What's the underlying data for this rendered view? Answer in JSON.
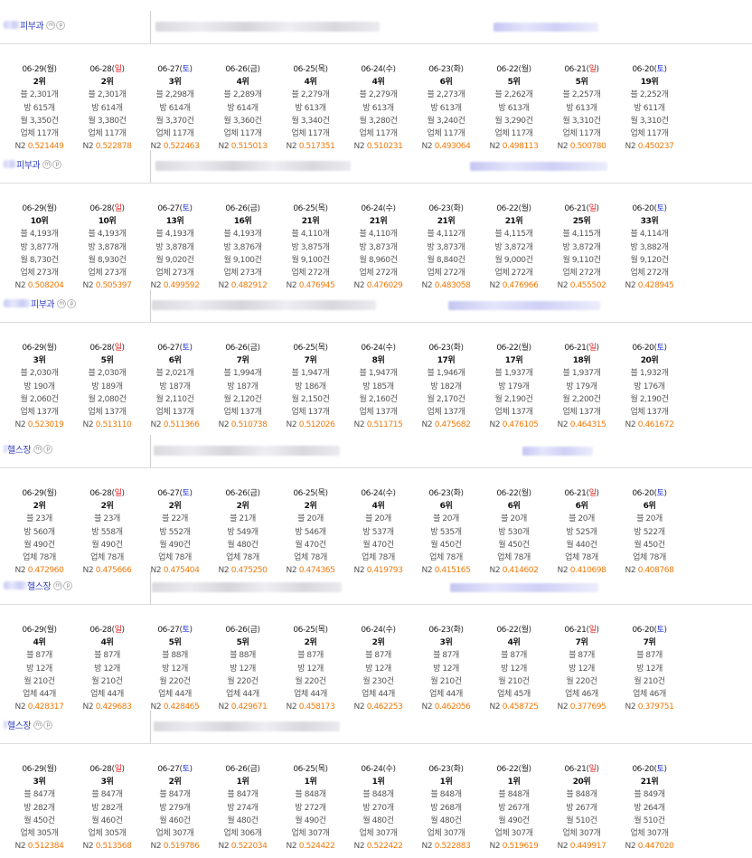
{
  "shops": [
    {
      "name": "피부과",
      "mp_icons": [
        "m",
        "p"
      ],
      "columns": [
        {
          "date": "06-29",
          "weekday": "월",
          "rank": "2위",
          "blog": "블 2,301개",
          "bang": "방 615개",
          "month": "월 3,350건",
          "biz": "업체 117개",
          "n2_label": "N2",
          "n2": "0.521449"
        },
        {
          "date": "06-28",
          "weekday": "일",
          "rank": "2위",
          "blog": "블 2,301개",
          "bang": "방 614개",
          "month": "월 3,380건",
          "biz": "업체 117개",
          "n2_label": "N2",
          "n2": "0.522878"
        },
        {
          "date": "06-27",
          "weekday": "토",
          "rank": "3위",
          "blog": "블 2,298개",
          "bang": "방 614개",
          "month": "월 3,370건",
          "biz": "업체 117개",
          "n2_label": "N2",
          "n2": "0.522463"
        },
        {
          "date": "06-26",
          "weekday": "금",
          "rank": "4위",
          "blog": "블 2,289개",
          "bang": "방 614개",
          "month": "월 3,360건",
          "biz": "업체 117개",
          "n2_label": "N2",
          "n2": "0.515013"
        },
        {
          "date": "06-25",
          "weekday": "목",
          "rank": "4위",
          "blog": "블 2,279개",
          "bang": "방 613개",
          "month": "월 3,340건",
          "biz": "업체 117개",
          "n2_label": "N2",
          "n2": "0.517351"
        },
        {
          "date": "06-24",
          "weekday": "수",
          "rank": "4위",
          "blog": "블 2,279개",
          "bang": "방 613개",
          "month": "월 3,280건",
          "biz": "업체 117개",
          "n2_label": "N2",
          "n2": "0.510231"
        },
        {
          "date": "06-23",
          "weekday": "화",
          "rank": "6위",
          "blog": "블 2,273개",
          "bang": "방 613개",
          "month": "월 3,240건",
          "biz": "업체 117개",
          "n2_label": "N2",
          "n2": "0.493064"
        },
        {
          "date": "06-22",
          "weekday": "월",
          "rank": "5위",
          "blog": "블 2,262개",
          "bang": "방 613개",
          "month": "월 3,290건",
          "biz": "업체 117개",
          "n2_label": "N2",
          "n2": "0.498113"
        },
        {
          "date": "06-21",
          "weekday": "일",
          "rank": "5위",
          "blog": "블 2,257개",
          "bang": "방 613개",
          "month": "월 3,310건",
          "biz": "업체 117개",
          "n2_label": "N2",
          "n2": "0.500780"
        },
        {
          "date": "06-20",
          "weekday": "토",
          "rank": "19위",
          "blog": "블 2,252개",
          "bang": "방 611개",
          "month": "월 3,310건",
          "biz": "업체 117개",
          "n2_label": "N2",
          "n2": "0.450237"
        }
      ]
    },
    {
      "name": "피부과",
      "mp_icons": [
        "m",
        "p"
      ],
      "columns": [
        {
          "date": "06-29",
          "weekday": "월",
          "rank": "10위",
          "blog": "블 4,193개",
          "bang": "방 3,877개",
          "month": "월 8,730건",
          "biz": "업체 273개",
          "n2_label": "N2",
          "n2": "0.508204"
        },
        {
          "date": "06-28",
          "weekday": "일",
          "rank": "10위",
          "blog": "블 4,193개",
          "bang": "방 3,878개",
          "month": "월 8,930건",
          "biz": "업체 273개",
          "n2_label": "N2",
          "n2": "0.505397"
        },
        {
          "date": "06-27",
          "weekday": "토",
          "rank": "13위",
          "blog": "블 4,193개",
          "bang": "방 3,878개",
          "month": "월 9,020건",
          "biz": "업체 273개",
          "n2_label": "N2",
          "n2": "0.499592"
        },
        {
          "date": "06-26",
          "weekday": "금",
          "rank": "16위",
          "blog": "블 4,193개",
          "bang": "방 3,876개",
          "month": "월 9,100건",
          "biz": "업체 273개",
          "n2_label": "N2",
          "n2": "0.482912"
        },
        {
          "date": "06-25",
          "weekday": "목",
          "rank": "21위",
          "blog": "블 4,110개",
          "bang": "방 3,875개",
          "month": "월 9,100건",
          "biz": "업체 272개",
          "n2_label": "N2",
          "n2": "0.476945"
        },
        {
          "date": "06-24",
          "weekday": "수",
          "rank": "21위",
          "blog": "블 4,110개",
          "bang": "방 3,873개",
          "month": "월 8,960건",
          "biz": "업체 272개",
          "n2_label": "N2",
          "n2": "0.476029"
        },
        {
          "date": "06-23",
          "weekday": "화",
          "rank": "21위",
          "blog": "블 4,112개",
          "bang": "방 3,873개",
          "month": "월 8,840건",
          "biz": "업체 272개",
          "n2_label": "N2",
          "n2": "0.483058"
        },
        {
          "date": "06-22",
          "weekday": "월",
          "rank": "21위",
          "blog": "블 4,115개",
          "bang": "방 3,872개",
          "month": "월 9,000건",
          "biz": "업체 272개",
          "n2_label": "N2",
          "n2": "0.476966"
        },
        {
          "date": "06-21",
          "weekday": "일",
          "rank": "25위",
          "blog": "블 4,115개",
          "bang": "방 3,872개",
          "month": "월 9,110건",
          "biz": "업체 272개",
          "n2_label": "N2",
          "n2": "0.455502"
        },
        {
          "date": "06-20",
          "weekday": "토",
          "rank": "33위",
          "blog": "블 4,114개",
          "bang": "방 3,882개",
          "month": "월 9,120건",
          "biz": "업체 272개",
          "n2_label": "N2",
          "n2": "0.428945"
        }
      ]
    },
    {
      "name": "피부과",
      "mp_icons": [
        "m",
        "p"
      ],
      "columns": [
        {
          "date": "06-29",
          "weekday": "월",
          "rank": "3위",
          "blog": "블 2,030개",
          "bang": "방 190개",
          "month": "월 2,060건",
          "biz": "업체 137개",
          "n2_label": "N2",
          "n2": "0.523019"
        },
        {
          "date": "06-28",
          "weekday": "일",
          "rank": "5위",
          "blog": "블 2,030개",
          "bang": "방 189개",
          "month": "월 2,080건",
          "biz": "업체 137개",
          "n2_label": "N2",
          "n2": "0.513110"
        },
        {
          "date": "06-27",
          "weekday": "토",
          "rank": "6위",
          "blog": "블 2,021개",
          "bang": "방 187개",
          "month": "월 2,110건",
          "biz": "업체 137개",
          "n2_label": "N2",
          "n2": "0.511366"
        },
        {
          "date": "06-26",
          "weekday": "금",
          "rank": "7위",
          "blog": "블 1,994개",
          "bang": "방 187개",
          "month": "월 2,120건",
          "biz": "업체 137개",
          "n2_label": "N2",
          "n2": "0.510738"
        },
        {
          "date": "06-25",
          "weekday": "목",
          "rank": "7위",
          "blog": "블 1,947개",
          "bang": "방 186개",
          "month": "월 2,150건",
          "biz": "업체 137개",
          "n2_label": "N2",
          "n2": "0.512026"
        },
        {
          "date": "06-24",
          "weekday": "수",
          "rank": "8위",
          "blog": "블 1,947개",
          "bang": "방 185개",
          "month": "월 2,160건",
          "biz": "업체 137개",
          "n2_label": "N2",
          "n2": "0.511715"
        },
        {
          "date": "06-23",
          "weekday": "화",
          "rank": "17위",
          "blog": "블 1,946개",
          "bang": "방 182개",
          "month": "월 2,170건",
          "biz": "업체 137개",
          "n2_label": "N2",
          "n2": "0.475682"
        },
        {
          "date": "06-22",
          "weekday": "월",
          "rank": "17위",
          "blog": "블 1,937개",
          "bang": "방 179개",
          "month": "월 2,190건",
          "biz": "업체 137개",
          "n2_label": "N2",
          "n2": "0.476105"
        },
        {
          "date": "06-21",
          "weekday": "일",
          "rank": "18위",
          "blog": "블 1,937개",
          "bang": "방 179개",
          "month": "월 2,200건",
          "biz": "업체 137개",
          "n2_label": "N2",
          "n2": "0.464315"
        },
        {
          "date": "06-20",
          "weekday": "토",
          "rank": "20위",
          "blog": "블 1,932개",
          "bang": "방 176개",
          "month": "월 2,190건",
          "biz": "업체 137개",
          "n2_label": "N2",
          "n2": "0.461672"
        }
      ]
    },
    {
      "name": "헬스장",
      "mp_icons": [
        "m",
        "p"
      ],
      "columns": [
        {
          "date": "06-29",
          "weekday": "월",
          "rank": "2위",
          "blog": "블 23개",
          "bang": "방 560개",
          "month": "월 490건",
          "biz": "업체 78개",
          "n2_label": "N2",
          "n2": "0.472960"
        },
        {
          "date": "06-28",
          "weekday": "일",
          "rank": "2위",
          "blog": "블 23개",
          "bang": "방 558개",
          "month": "월 490건",
          "biz": "업체 78개",
          "n2_label": "N2",
          "n2": "0.475666"
        },
        {
          "date": "06-27",
          "weekday": "토",
          "rank": "2위",
          "blog": "블 22개",
          "bang": "방 552개",
          "month": "월 490건",
          "biz": "업체 78개",
          "n2_label": "N2",
          "n2": "0.475404"
        },
        {
          "date": "06-26",
          "weekday": "금",
          "rank": "2위",
          "blog": "블 21개",
          "bang": "방 549개",
          "month": "월 480건",
          "biz": "업체 78개",
          "n2_label": "N2",
          "n2": "0.475250"
        },
        {
          "date": "06-25",
          "weekday": "목",
          "rank": "2위",
          "blog": "블 20개",
          "bang": "방 546개",
          "month": "월 470건",
          "biz": "업체 78개",
          "n2_label": "N2",
          "n2": "0.474365"
        },
        {
          "date": "06-24",
          "weekday": "수",
          "rank": "4위",
          "blog": "블 20개",
          "bang": "방 537개",
          "month": "월 470건",
          "biz": "업체 78개",
          "n2_label": "N2",
          "n2": "0.419793"
        },
        {
          "date": "06-23",
          "weekday": "화",
          "rank": "6위",
          "blog": "블 20개",
          "bang": "방 535개",
          "month": "월 450건",
          "biz": "업체 78개",
          "n2_label": "N2",
          "n2": "0.415165"
        },
        {
          "date": "06-22",
          "weekday": "월",
          "rank": "6위",
          "blog": "블 20개",
          "bang": "방 530개",
          "month": "월 450건",
          "biz": "업체 78개",
          "n2_label": "N2",
          "n2": "0.414602"
        },
        {
          "date": "06-21",
          "weekday": "일",
          "rank": "6위",
          "blog": "블 20개",
          "bang": "방 525개",
          "month": "월 440건",
          "biz": "업체 78개",
          "n2_label": "N2",
          "n2": "0.410698"
        },
        {
          "date": "06-20",
          "weekday": "토",
          "rank": "6위",
          "blog": "블 20개",
          "bang": "방 522개",
          "month": "월 450건",
          "biz": "업체 78개",
          "n2_label": "N2",
          "n2": "0.408768"
        }
      ]
    },
    {
      "name": "헬스장",
      "mp_icons": [
        "m",
        "p"
      ],
      "columns": [
        {
          "date": "06-29",
          "weekday": "월",
          "rank": "4위",
          "blog": "블 87개",
          "bang": "방 12개",
          "month": "월 210건",
          "biz": "업체 44개",
          "n2_label": "N2",
          "n2": "0.428317"
        },
        {
          "date": "06-28",
          "weekday": "일",
          "rank": "4위",
          "blog": "블 87개",
          "bang": "방 12개",
          "month": "월 210건",
          "biz": "업체 44개",
          "n2_label": "N2",
          "n2": "0.429683"
        },
        {
          "date": "06-27",
          "weekday": "토",
          "rank": "5위",
          "blog": "블 88개",
          "bang": "방 12개",
          "month": "월 220건",
          "biz": "업체 44개",
          "n2_label": "N2",
          "n2": "0.428465"
        },
        {
          "date": "06-26",
          "weekday": "금",
          "rank": "5위",
          "blog": "블 88개",
          "bang": "방 12개",
          "month": "월 220건",
          "biz": "업체 44개",
          "n2_label": "N2",
          "n2": "0.429671"
        },
        {
          "date": "06-25",
          "weekday": "목",
          "rank": "2위",
          "blog": "블 87개",
          "bang": "방 12개",
          "month": "월 220건",
          "biz": "업체 44개",
          "n2_label": "N2",
          "n2": "0.458173"
        },
        {
          "date": "06-24",
          "weekday": "수",
          "rank": "2위",
          "blog": "블 87개",
          "bang": "방 12개",
          "month": "월 230건",
          "biz": "업체 44개",
          "n2_label": "N2",
          "n2": "0.462253"
        },
        {
          "date": "06-23",
          "weekday": "화",
          "rank": "3위",
          "blog": "블 87개",
          "bang": "방 12개",
          "month": "월 210건",
          "biz": "업체 44개",
          "n2_label": "N2",
          "n2": "0.462056"
        },
        {
          "date": "06-22",
          "weekday": "월",
          "rank": "4위",
          "blog": "블 87개",
          "bang": "방 12개",
          "month": "월 210건",
          "biz": "업체 45개",
          "n2_label": "N2",
          "n2": "0.458725"
        },
        {
          "date": "06-21",
          "weekday": "일",
          "rank": "7위",
          "blog": "블 87개",
          "bang": "방 12개",
          "month": "월 220건",
          "biz": "업체 46개",
          "n2_label": "N2",
          "n2": "0.377695"
        },
        {
          "date": "06-20",
          "weekday": "토",
          "rank": "7위",
          "blog": "블 87개",
          "bang": "방 12개",
          "month": "월 210건",
          "biz": "업체 46개",
          "n2_label": "N2",
          "n2": "0.379751"
        }
      ]
    },
    {
      "name": "헬스장",
      "mp_icons": [
        "m",
        "p"
      ],
      "columns": [
        {
          "date": "06-29",
          "weekday": "월",
          "rank": "3위",
          "blog": "블 847개",
          "bang": "방 282개",
          "month": "월 450건",
          "biz": "업체 305개",
          "n2_label": "N2",
          "n2": "0.512384"
        },
        {
          "date": "06-28",
          "weekday": "일",
          "rank": "3위",
          "blog": "블 847개",
          "bang": "방 282개",
          "month": "월 460건",
          "biz": "업체 305개",
          "n2_label": "N2",
          "n2": "0.513568"
        },
        {
          "date": "06-27",
          "weekday": "토",
          "rank": "2위",
          "blog": "블 847개",
          "bang": "방 279개",
          "month": "월 460건",
          "biz": "업체 307개",
          "n2_label": "N2",
          "n2": "0.519786"
        },
        {
          "date": "06-26",
          "weekday": "금",
          "rank": "1위",
          "blog": "블 847개",
          "bang": "방 274개",
          "month": "월 480건",
          "biz": "업체 306개",
          "n2_label": "N2",
          "n2": "0.522034"
        },
        {
          "date": "06-25",
          "weekday": "목",
          "rank": "1위",
          "blog": "블 848개",
          "bang": "방 272개",
          "month": "월 490건",
          "biz": "업체 307개",
          "n2_label": "N2",
          "n2": "0.524422"
        },
        {
          "date": "06-24",
          "weekday": "수",
          "rank": "1위",
          "blog": "블 848개",
          "bang": "방 270개",
          "month": "월 480건",
          "biz": "업체 307개",
          "n2_label": "N2",
          "n2": "0.522422"
        },
        {
          "date": "06-23",
          "weekday": "화",
          "rank": "1위",
          "blog": "블 848개",
          "bang": "방 268개",
          "month": "월 480건",
          "biz": "업체 307개",
          "n2_label": "N2",
          "n2": "0.522883"
        },
        {
          "date": "06-22",
          "weekday": "월",
          "rank": "1위",
          "blog": "블 848개",
          "bang": "방 267개",
          "month": "월 490건",
          "biz": "업체 307개",
          "n2_label": "N2",
          "n2": "0.519619"
        },
        {
          "date": "06-21",
          "weekday": "일",
          "rank": "20위",
          "blog": "블 848개",
          "bang": "방 267개",
          "month": "월 510건",
          "biz": "업체 307개",
          "n2_label": "N2",
          "n2": "0.449917"
        },
        {
          "date": "06-20",
          "weekday": "토",
          "rank": "21위",
          "blog": "블 849개",
          "bang": "방 264개",
          "month": "월 510건",
          "biz": "업체 307개",
          "n2_label": "N2",
          "n2": "0.447020"
        }
      ]
    }
  ],
  "colors": {
    "saturday": "#2233dd",
    "sunday": "#dd2222",
    "n2_value": "#f07a0a",
    "shop_name": "#3340c0"
  }
}
